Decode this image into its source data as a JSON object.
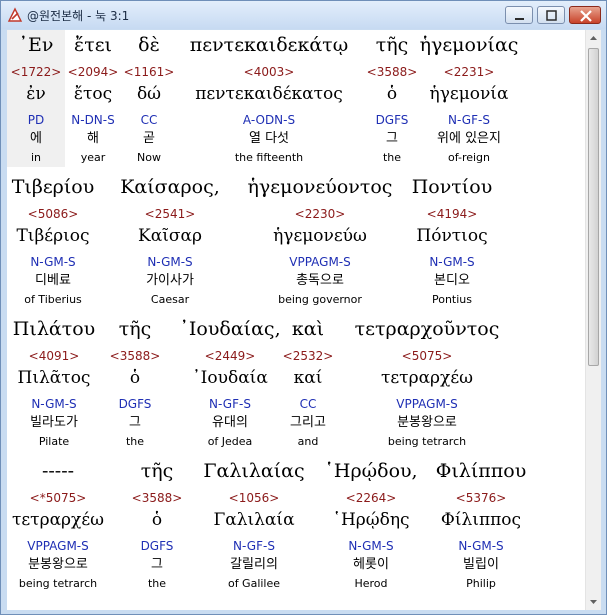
{
  "window": {
    "title": "@원전본해 - 눅 3:1",
    "min_label": "minimize",
    "max_label": "maximize",
    "close_label": "close"
  },
  "rows": [
    {
      "words": [
        {
          "greek": "᾿Εν",
          "strong": "<1722>",
          "lemma": "ἐν",
          "morph": "PD",
          "korean": "에",
          "english": "in"
        },
        {
          "greek": "ἔτει",
          "strong": "<2094>",
          "lemma": "ἔτος",
          "morph": "N-DN-S",
          "korean": "해",
          "english": "year"
        },
        {
          "greek": "δὲ",
          "strong": "<1161>",
          "lemma": "δώ",
          "morph": "CC",
          "korean": "곧",
          "english": "Now"
        },
        {
          "greek": "πεντεκαιδεκάτῳ",
          "strong": "<4003>",
          "lemma": "πεντεκαιδέκατος",
          "morph": "A-ODN-S",
          "korean": "열 다섯",
          "english": "the fifteenth"
        },
        {
          "greek": "τῆς",
          "strong": "<3588>",
          "lemma": "ὁ",
          "morph": "DGFS",
          "korean": "그",
          "english": "the"
        },
        {
          "greek": "ἡγεμονίας",
          "strong": "<2231>",
          "lemma": "ἡγεμονία",
          "morph": "N-GF-S",
          "korean": "위에 있은지",
          "english": "of-reign"
        }
      ]
    },
    {
      "words": [
        {
          "greek": "Τιβερίου",
          "strong": "<5086>",
          "lemma": "Τιβέριος",
          "morph": "N-GM-S",
          "korean": "디베료",
          "english": "of Tiberius"
        },
        {
          "greek": "Καίσαρος,",
          "strong": "<2541>",
          "lemma": "Καῖσαρ",
          "morph": "N-GM-S",
          "korean": "가이사가",
          "english": "Caesar"
        },
        {
          "greek": "ἡγεμονεύοντος",
          "strong": "<2230>",
          "lemma": "ἡγεμονεύω",
          "morph": "VPPAGM-S",
          "korean": "총독으로",
          "english": "being governor"
        },
        {
          "greek": "Ποντίου",
          "strong": "<4194>",
          "lemma": "Πόντιος",
          "morph": "N-GM-S",
          "korean": "본디오",
          "english": "Pontius"
        }
      ]
    },
    {
      "words": [
        {
          "greek": "Πιλάτου",
          "strong": "<4091>",
          "lemma": "Πιλᾶτος",
          "morph": "N-GM-S",
          "korean": "빌라도가",
          "english": "Pilate"
        },
        {
          "greek": "τῆς",
          "strong": "<3588>",
          "lemma": "ὁ",
          "morph": "DGFS",
          "korean": "그",
          "english": "the"
        },
        {
          "greek": "᾿Ιουδαίας,",
          "strong": "<2449>",
          "lemma": "᾿Ιουδαία",
          "morph": "N-GF-S",
          "korean": "유대의",
          "english": "of Jedea"
        },
        {
          "greek": "καὶ",
          "strong": "<2532>",
          "lemma": "καί",
          "morph": "CC",
          "korean": "그리고",
          "english": "and"
        },
        {
          "greek": "τετραρχοῦντος",
          "strong": "<5075>",
          "lemma": "τετραρχέω",
          "morph": "VPPAGM-S",
          "korean": "분봉왕으로",
          "english": "being tetrarch"
        }
      ]
    },
    {
      "words": [
        {
          "greek": "-----",
          "strong": "<*5075>",
          "lemma": "τετραρχέω",
          "morph": "VPPAGM-S",
          "korean": "분봉왕으로",
          "english": "being tetrarch"
        },
        {
          "greek": "τῆς",
          "strong": "<3588>",
          "lemma": "ὁ",
          "morph": "DGFS",
          "korean": "그",
          "english": "the"
        },
        {
          "greek": "Γαλιλαίας",
          "strong": "<1056>",
          "lemma": "Γαλιλαία",
          "morph": "N-GF-S",
          "korean": "갈릴리의",
          "english": "of Galilee"
        },
        {
          "greek": "῾Ηρῴδου,",
          "strong": "<2264>",
          "lemma": "῾Ηρῴδης",
          "morph": "N-GM-S",
          "korean": "헤롯이",
          "english": "Herod"
        },
        {
          "greek": "Φιλίππου",
          "strong": "<5376>",
          "lemma": "Φίλιππος",
          "morph": "N-GM-S",
          "korean": "빌립이",
          "english": "Philip"
        }
      ]
    }
  ]
}
